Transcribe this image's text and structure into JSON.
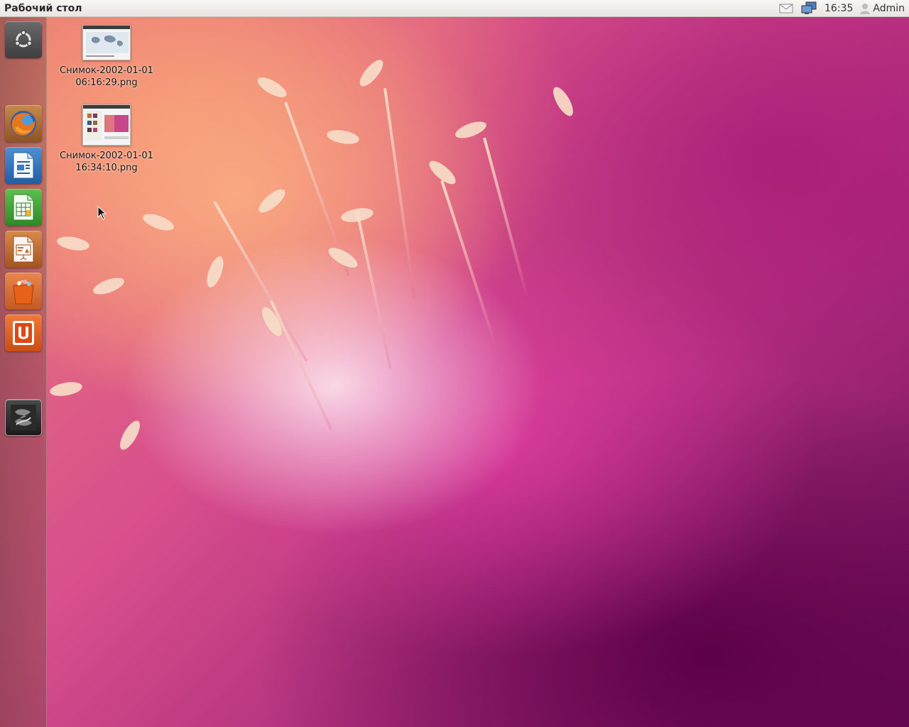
{
  "panel": {
    "title": "Рабочий стол",
    "clock": "16:35",
    "user": "Admin"
  },
  "launcher": {
    "items": [
      {
        "name": "Dash home",
        "icon": "ubuntu-logo-icon"
      },
      {
        "name": "Firefox",
        "icon": "firefox-icon"
      },
      {
        "name": "LibreOffice Writer",
        "icon": "writer-icon"
      },
      {
        "name": "LibreOffice Calc",
        "icon": "calc-icon"
      },
      {
        "name": "LibreOffice Impress",
        "icon": "impress-icon"
      },
      {
        "name": "Ubuntu Software Center",
        "icon": "software-center-icon"
      },
      {
        "name": "Ubuntu One",
        "icon": "ubuntu-one-icon"
      },
      {
        "name": "Workspace switcher",
        "icon": "workspaces-icon"
      }
    ]
  },
  "desktop": {
    "files": [
      {
        "label": "Снимок-2002-01-01\n06:16:29.png"
      },
      {
        "label": "Снимок-2002-01-01\n16:34:10.png"
      }
    ]
  },
  "colors": {
    "panel_bg": "#f0efeb",
    "launcher_bg": "#7a4545",
    "ubuntu_one_orange": "#dd4814"
  }
}
